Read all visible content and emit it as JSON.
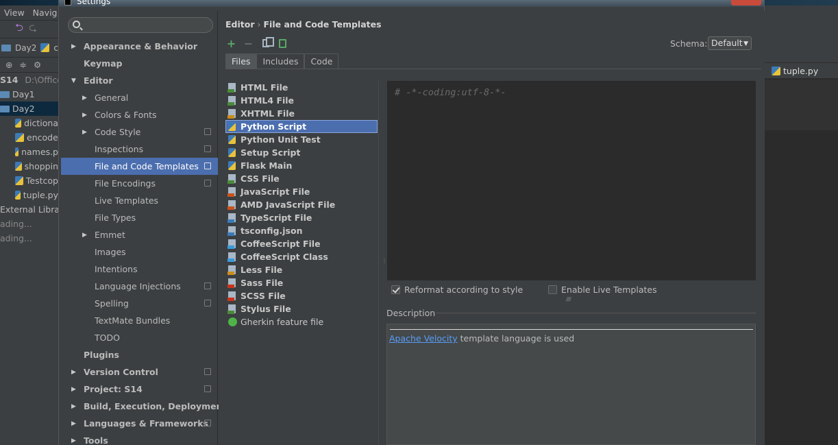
{
  "ide": {
    "menu": [
      "View",
      "Navig"
    ],
    "crumbs": [
      "Day2",
      "c"
    ],
    "project_root": "S14",
    "project_path": "D:\\Office\\",
    "tree": [
      {
        "label": "Day1",
        "type": "folder"
      },
      {
        "label": "Day2",
        "type": "folder",
        "selected": true
      },
      {
        "label": "dictiona",
        "type": "py"
      },
      {
        "label": "encode",
        "type": "py"
      },
      {
        "label": "names.p",
        "type": "py"
      },
      {
        "label": "shoppin",
        "type": "py"
      },
      {
        "label": "Testcop",
        "type": "py"
      },
      {
        "label": "tuple.py",
        "type": "py"
      },
      {
        "label": "External Librar",
        "type": "lib"
      },
      {
        "label": "ading...",
        "type": "loading"
      },
      {
        "label": "ading...",
        "type": "loading"
      }
    ],
    "right_tab": "tuple.py"
  },
  "dialog": {
    "title": "Settings",
    "search": {
      "placeholder": "",
      "value": ""
    },
    "settings_tree": [
      {
        "label": "Appearance & Behavior",
        "level": 0,
        "arrow": "▶",
        "proj": false
      },
      {
        "label": "Keymap",
        "level": 0,
        "arrow": "",
        "proj": false
      },
      {
        "label": "Editor",
        "level": 0,
        "arrow": "▼",
        "proj": false
      },
      {
        "label": "General",
        "level": 1,
        "arrow": "▶",
        "proj": false
      },
      {
        "label": "Colors & Fonts",
        "level": 1,
        "arrow": "▶",
        "proj": false
      },
      {
        "label": "Code Style",
        "level": 1,
        "arrow": "▶",
        "proj": true
      },
      {
        "label": "Inspections",
        "level": 1,
        "arrow": "",
        "proj": true
      },
      {
        "label": "File and Code Templates",
        "level": 1,
        "arrow": "",
        "proj": true,
        "selected": true
      },
      {
        "label": "File Encodings",
        "level": 1,
        "arrow": "",
        "proj": true
      },
      {
        "label": "Live Templates",
        "level": 1,
        "arrow": "",
        "proj": false
      },
      {
        "label": "File Types",
        "level": 1,
        "arrow": "",
        "proj": false
      },
      {
        "label": "Emmet",
        "level": 1,
        "arrow": "▶",
        "proj": false
      },
      {
        "label": "Images",
        "level": 1,
        "arrow": "",
        "proj": false
      },
      {
        "label": "Intentions",
        "level": 1,
        "arrow": "",
        "proj": false
      },
      {
        "label": "Language Injections",
        "level": 1,
        "arrow": "",
        "proj": true
      },
      {
        "label": "Spelling",
        "level": 1,
        "arrow": "",
        "proj": true
      },
      {
        "label": "TextMate Bundles",
        "level": 1,
        "arrow": "",
        "proj": false
      },
      {
        "label": "TODO",
        "level": 1,
        "arrow": "",
        "proj": false
      },
      {
        "label": "Plugins",
        "level": 0,
        "arrow": "",
        "proj": false
      },
      {
        "label": "Version Control",
        "level": 0,
        "arrow": "▶",
        "proj": true
      },
      {
        "label": "Project: S14",
        "level": 0,
        "arrow": "▶",
        "proj": true
      },
      {
        "label": "Build, Execution, Deployment",
        "level": 0,
        "arrow": "▶",
        "proj": false
      },
      {
        "label": "Languages & Frameworks",
        "level": 0,
        "arrow": "▶",
        "proj": true
      },
      {
        "label": "Tools",
        "level": 0,
        "arrow": "▶",
        "proj": false
      }
    ],
    "breadcrumb": [
      "Editor",
      "File and Code Templates"
    ],
    "breadcrumb_sep": "›",
    "schema_label": "Schema:",
    "schema_value": "Default",
    "tabs": [
      "Files",
      "Includes",
      "Code"
    ],
    "active_tab": "Files",
    "templates": [
      {
        "label": "HTML File",
        "icon": "html-file-icon",
        "color": "#4a8a3a"
      },
      {
        "label": "HTML4 File",
        "icon": "html-file-icon",
        "color": "#4a8a3a"
      },
      {
        "label": "XHTML File",
        "icon": "xhtml-file-icon",
        "color": "#c98d1d"
      },
      {
        "label": "Python Script",
        "icon": "python-file-icon",
        "py": true,
        "selected": true
      },
      {
        "label": "Python Unit Test",
        "icon": "python-file-icon",
        "py": true
      },
      {
        "label": "Setup Script",
        "icon": "python-file-icon",
        "py": true
      },
      {
        "label": "Flask Main",
        "icon": "python-file-icon",
        "py": true
      },
      {
        "label": "CSS File",
        "icon": "css-file-icon",
        "color": "#4a8a3a"
      },
      {
        "label": "JavaScript File",
        "icon": "js-file-icon",
        "color": "#c9541d"
      },
      {
        "label": "AMD JavaScript File",
        "icon": "js-file-icon",
        "color": "#c9541d"
      },
      {
        "label": "TypeScript File",
        "icon": "ts-file-icon",
        "color": "#3a7ab8"
      },
      {
        "label": "tsconfig.json",
        "icon": "json-file-icon",
        "color": "#3a7ab8"
      },
      {
        "label": "CoffeeScript File",
        "icon": "coffee-file-icon",
        "color": "#3a9ad8"
      },
      {
        "label": "CoffeeScript Class",
        "icon": "coffee-file-icon",
        "color": "#3a9ad8"
      },
      {
        "label": "Less File",
        "icon": "less-file-icon",
        "color": "#c98d1d"
      },
      {
        "label": "Sass File",
        "icon": "sass-file-icon",
        "color": "#c9341d"
      },
      {
        "label": "SCSS File",
        "icon": "scss-file-icon",
        "color": "#c9341d"
      },
      {
        "label": "Stylus File",
        "icon": "stylus-file-icon",
        "color": "#4a8a3a"
      },
      {
        "label": "Gherkin feature file",
        "icon": "gherkin-icon",
        "circle": true,
        "normal": true
      }
    ],
    "editor_text": "# -*-coding:utf-8-*-",
    "reformat_label": "Reformat according to style",
    "reformat_checked": true,
    "live_templates_label": "Enable Live Templates",
    "live_templates_checked": false,
    "description_label": "Description",
    "description_link": "Apache Velocity",
    "description_rest": " template language is used"
  }
}
